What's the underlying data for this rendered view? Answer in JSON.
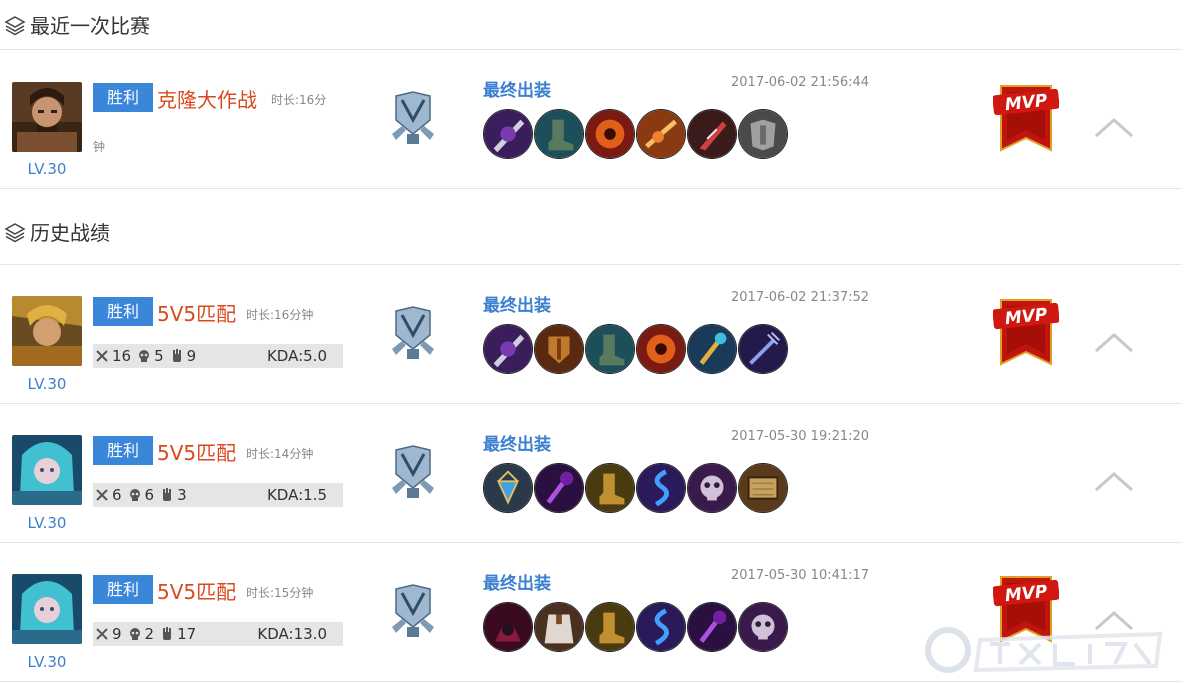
{
  "sections": {
    "recent": {
      "title": "最近一次比赛"
    },
    "history": {
      "title": "历史战绩"
    }
  },
  "labels": {
    "items_title": "最终出装",
    "kda_prefix": "KDA:"
  },
  "recent_match": {
    "level": "LV.30",
    "result": "胜利",
    "mode": "克隆大作战",
    "duration_line1": "时长:16分",
    "duration_line2": "钟",
    "timestamp": "2017-06-02 21:56:44",
    "mvp": true,
    "mvp_label": "MVP",
    "items": [
      "dark-blade-icon",
      "boots-icon",
      "red-eye-orb-icon",
      "fire-bow-icon",
      "red-blade-icon",
      "armor-icon"
    ]
  },
  "history": [
    {
      "level": "LV.30",
      "result": "胜利",
      "mode": "5V5匹配",
      "duration": "时长:16分钟",
      "kills": "16",
      "deaths": "5",
      "assists": "9",
      "kda": "KDA:5.0",
      "timestamp": "2017-06-02 21:37:52",
      "mvp": true,
      "mvp_label": "MVP",
      "items": [
        "dark-blade-icon",
        "war-shield-icon",
        "boots-icon",
        "red-eye-orb-icon",
        "gold-staff-icon",
        "trident-icon"
      ]
    },
    {
      "level": "LV.30",
      "result": "胜利",
      "mode": "5V5匹配",
      "duration": "时长:14分钟",
      "kills": "6",
      "deaths": "6",
      "assists": "3",
      "kda": "KDA:1.5",
      "timestamp": "2017-05-30 19:21:20",
      "mvp": false,
      "items": [
        "pendant-icon",
        "purple-scepter-icon",
        "gold-boots-icon",
        "blue-serpent-icon",
        "skull-mask-icon",
        "book-icon"
      ]
    },
    {
      "level": "LV.30",
      "result": "胜利",
      "mode": "5V5匹配",
      "duration": "时长:15分钟",
      "kills": "9",
      "deaths": "2",
      "assists": "17",
      "kda": "KDA:13.0",
      "timestamp": "2017-05-30 10:41:17",
      "mvp": true,
      "mvp_label": "MVP",
      "items": [
        "red-hood-icon",
        "cloak-icon",
        "gold-boots-icon",
        "blue-serpent-icon",
        "purple-scepter-icon",
        "skull-mask-icon"
      ]
    }
  ],
  "colors": {
    "accent_blue": "#3a86d8",
    "mode_red": "#d9491e",
    "stats_bg": "#e5e5e5"
  },
  "watermark": {
    "icon": "watermark-logo-icon"
  }
}
